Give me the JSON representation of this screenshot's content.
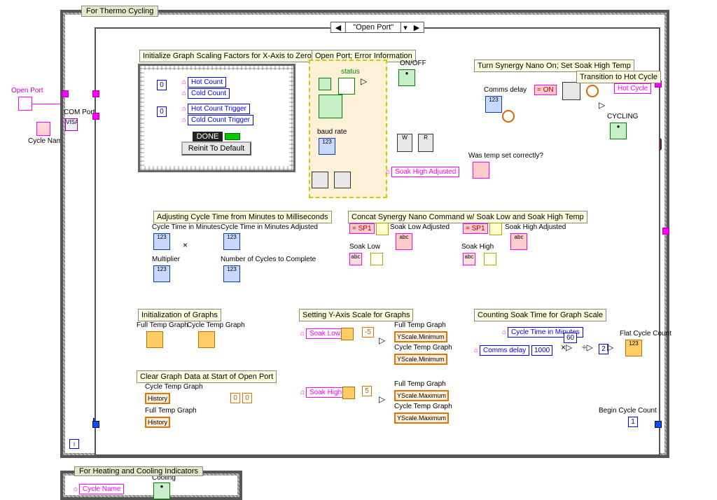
{
  "outer_loop_label": "For Thermo Cycling",
  "case_selector": "\"Open Port\"",
  "left_terminal": "Open Port",
  "cycle_name": "Cycle Name",
  "com_port": "COM Port",
  "init_graph": {
    "title": "Initialize Graph Scaling Factors for X-Axis to Zero",
    "const_zero_a": "0",
    "const_zero_b": "0",
    "hot_count": "Hot Count",
    "cold_count": "Cold Count",
    "hot_trigger": "Hot Count Trigger",
    "cold_trigger": "Cold Count Trigger",
    "done": "DONE",
    "reinit": "Reinit To Default"
  },
  "open_port": {
    "title": "Open Port; Error Information",
    "status": "status",
    "baud": "baud rate",
    "onoff": "ON/OFF"
  },
  "turn_on": {
    "title": "Turn Synergy Nano On; Set Soak High Temp",
    "comms_delay": "Comms delay",
    "on_const": "= ON",
    "was_set": "Was temp set correctly?",
    "soak_high_adj": "Soak High Adjusted"
  },
  "transition": {
    "title": "Transition to Hot Cycle",
    "hot_cycle": "Hot Cycle",
    "cycling": "CYCLING"
  },
  "adjust_time": {
    "title": "Adjusting Cycle Time from Minutes to Milliseconds",
    "cycle_min": "Cycle Time in Minutes",
    "out": "Cycle Time in Minutes Adjusted",
    "multiplier": "Multiplier",
    "num_cycles": "Number of Cycles to Complete"
  },
  "concat": {
    "title": "Concat Synergy Nano Command w/ Soak Low and Soak High Temp",
    "sp1a": "= SP1",
    "sp1b": "= SP1",
    "low_adj": "Soak Low Adjusted",
    "high_adj": "Soak High Adjusted",
    "low": "Soak Low",
    "high": "Soak High"
  },
  "init_graphs": {
    "title": "Initialization of Graphs",
    "full": "Full Temp Graph",
    "cycle": "Cycle Temp Graph"
  },
  "yscale": {
    "title": "Setting Y-Axis Scale for Graphs",
    "soak_low": "Soak Low",
    "soak_high": "Soak High",
    "neg5": "-5",
    "pos5": "5",
    "full": "Full Temp Graph",
    "cycle": "Cycle Temp Graph",
    "min": "YScale.Minimum",
    "max": "YScale.Maximum"
  },
  "count_soak": {
    "title": "Counting Soak Time for Graph Scale",
    "ctm": "Cycle Time in Minutes",
    "comms": "Comms delay",
    "c1000": "1000",
    "c60": "60",
    "c2": "2",
    "flat": "Flat Cycle Count"
  },
  "clear_graph": {
    "title": "Clear Graph Data at Start of Open Port",
    "cycle": "Cycle Temp Graph",
    "full": "Full Temp Graph",
    "hist": "History",
    "zeros": "0",
    "zeros2": "0"
  },
  "begin_count": {
    "label": "Begin Cycle Count",
    "one": "1"
  },
  "sect2": {
    "title": "For Heating and Cooling Indicators",
    "cycle_name": "Cycle Name",
    "cooling": "Cooling"
  }
}
